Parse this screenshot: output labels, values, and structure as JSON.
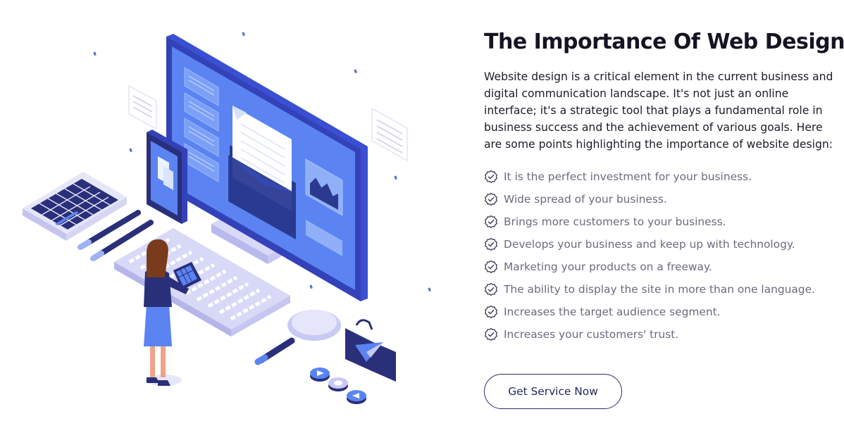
{
  "section": {
    "title": "The Importance Of Web Design",
    "intro": "Website design is a critical element in the current business and digital communication landscape. It's not just an online interface; it's a strategic tool that plays a fundamental role in business success and the achievement of various goals. Here are some points highlighting the importance of website design:",
    "benefits": [
      "It is the perfect investment for your business.",
      "Wide spread of your business.",
      "Brings more customers to your business.",
      "Develops your business and keep up with technology.",
      "Marketing your products on a freeway.",
      "The ability to display the site in more than one language.",
      "Increases the target audience segment.",
      "Increases your customers' trust."
    ],
    "benefit_icon": "check-badge-icon",
    "cta_label": "Get Service Now"
  },
  "illustration": {
    "description_icon": "web-design-illustration"
  },
  "colors": {
    "title": "#151423",
    "body_text": "#1c1c28",
    "list_text": "#6b6b7e",
    "accent_navy": "#2b2f66",
    "monitor_blue": "#5b84f2",
    "lavender": "#c9c9f5"
  }
}
